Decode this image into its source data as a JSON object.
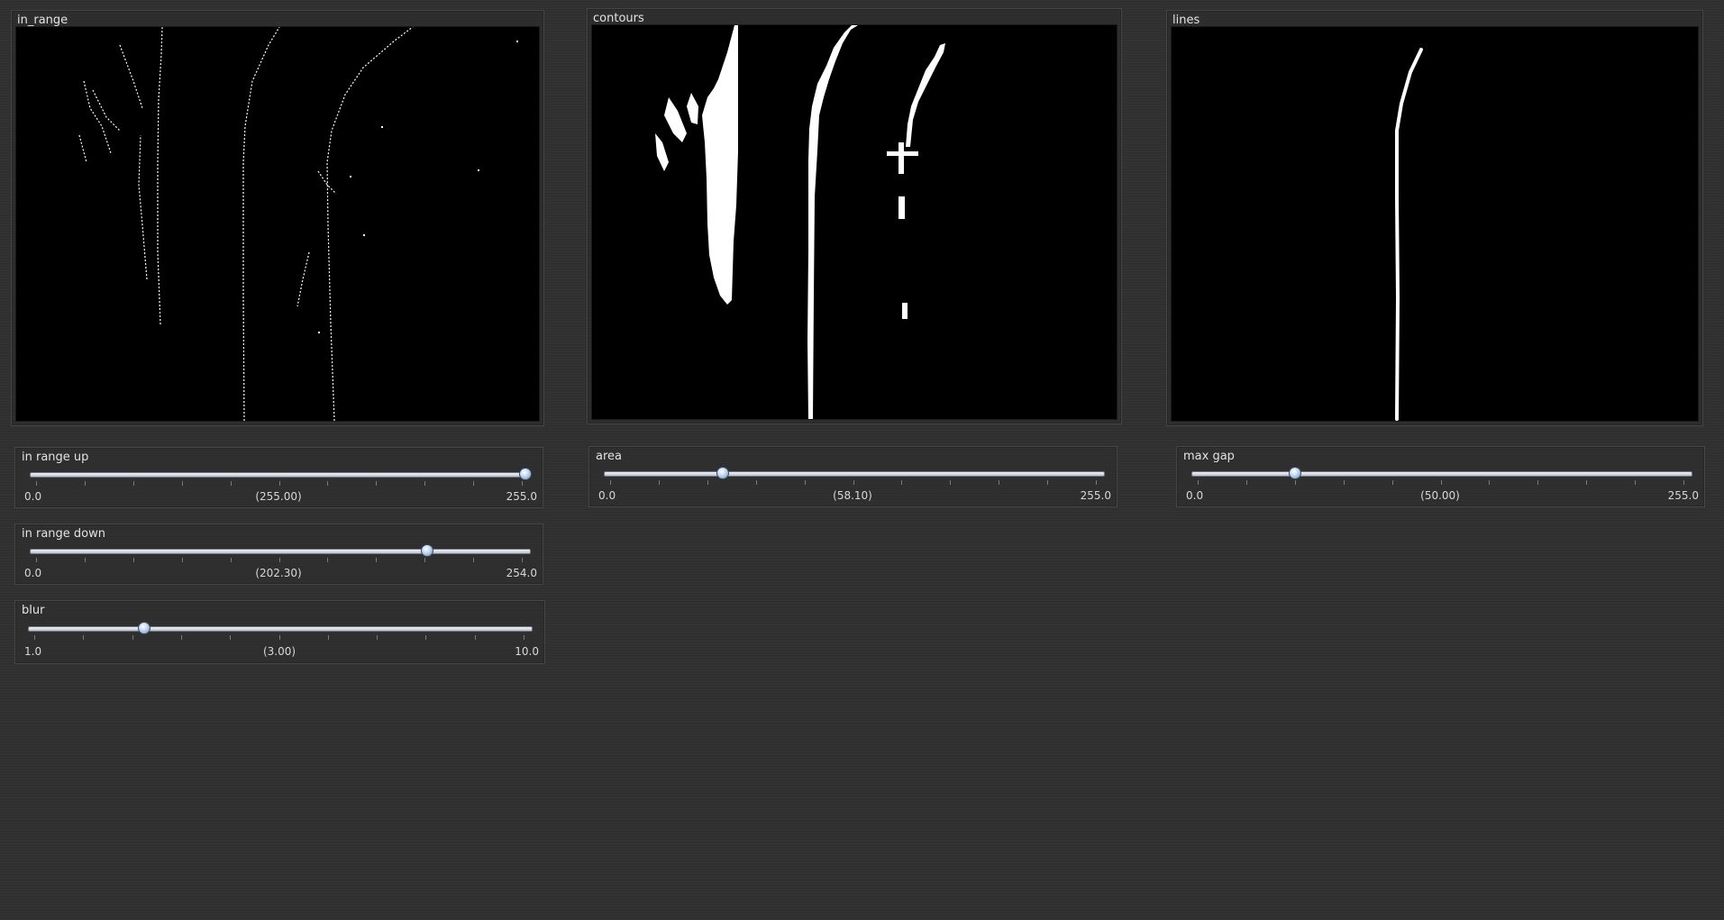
{
  "panels": {
    "in_range": {
      "title": "in_range"
    },
    "contours": {
      "title": "contours"
    },
    "lines": {
      "title": "lines"
    }
  },
  "sliders": {
    "in_range_up": {
      "label": "in range up",
      "min": "0.0",
      "current": "(255.00)",
      "max": "255.0",
      "fraction": 0.992
    },
    "in_range_down": {
      "label": "in range down",
      "min": "0.0",
      "current": "(202.30)",
      "max": "254.0",
      "fraction": 0.796
    },
    "blur": {
      "label": "blur",
      "min": "1.0",
      "current": "(3.00)",
      "max": "10.0",
      "fraction": 0.228
    },
    "area": {
      "label": "area",
      "min": "0.0",
      "current": "(58.10)",
      "max": "255.0",
      "fraction": 0.236
    },
    "max_gap": {
      "label": "max gap",
      "min": "0.0",
      "current": "(50.00)",
      "max": "255.0",
      "fraction": 0.205
    }
  },
  "colors": {
    "background": "#2f2f2f",
    "image_background": "#000000",
    "foreground": "#ffffff",
    "accent": "#6f8fb8"
  }
}
